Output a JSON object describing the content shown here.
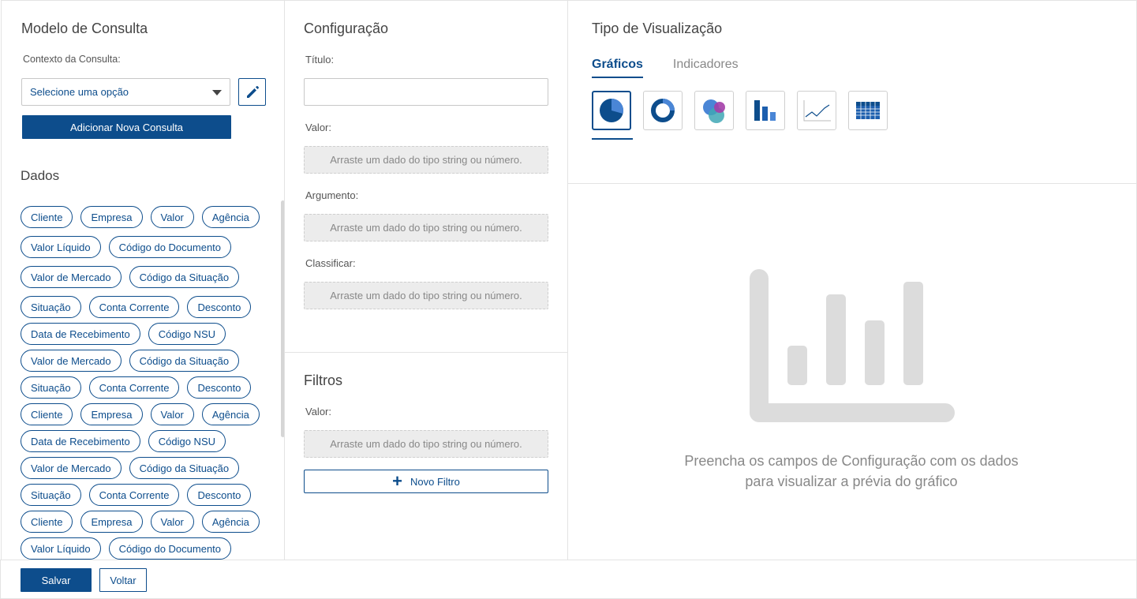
{
  "modelo": {
    "title": "Modelo de Consulta",
    "context_label": "Contexto da Consulta:",
    "select_value": "Selecione uma opção",
    "add_button": "Adicionar Nova Consulta"
  },
  "dados": {
    "title": "Dados",
    "rows": [
      [
        "Cliente",
        "Empresa",
        "Valor",
        "Agência"
      ],
      [
        "Valor Líquido",
        "Código do Documento"
      ],
      [
        "Valor de Mercado",
        "Código da Situação"
      ],
      [
        "Situação",
        "Conta Corrente",
        "Desconto"
      ],
      [
        "Data de Recebimento",
        "Código NSU"
      ],
      [
        "Valor de Mercado",
        "Código da Situação"
      ],
      [
        "Situação",
        "Conta Corrente",
        "Desconto"
      ],
      [
        "Cliente",
        "Empresa",
        "Valor",
        "Agência"
      ],
      [
        "Data de Recebimento",
        "Código NSU"
      ],
      [
        "Valor de Mercado",
        "Código da Situação"
      ],
      [
        "Situação",
        "Conta Corrente",
        "Desconto"
      ],
      [
        "Cliente",
        "Empresa",
        "Valor",
        "Agência"
      ],
      [
        "Valor Líquido",
        "Código do Documento"
      ]
    ]
  },
  "config": {
    "title": "Configuração",
    "titulo_label": "Título:",
    "titulo_value": "",
    "valor_label": "Valor:",
    "argumento_label": "Argumento:",
    "classificar_label": "Classificar:",
    "drop_placeholder": "Arraste um dado do tipo string ou número."
  },
  "filtros": {
    "title": "Filtros",
    "valor_label": "Valor:",
    "drop_placeholder": "Arraste um dado do tipo string ou número.",
    "novo_filtro": "Novo Filtro"
  },
  "tipo": {
    "title": "Tipo de Visualização",
    "tabs": [
      "Gráficos",
      "Indicadores"
    ],
    "active_tab": "Gráficos",
    "chart_types": [
      "pie-chart-icon",
      "donut-chart-icon",
      "bubble-chart-icon",
      "bar-chart-icon",
      "line-chart-icon",
      "table-chart-icon"
    ]
  },
  "preview": {
    "line1": "Preencha os campos de Configuração com os dados",
    "line2": "para visualizar a prévia do gráfico"
  },
  "footer": {
    "save": "Salvar",
    "back": "Voltar"
  },
  "colors": {
    "primary": "#0d4d8c",
    "border": "#e3e3e3",
    "placeholder_bg": "#ececec"
  }
}
